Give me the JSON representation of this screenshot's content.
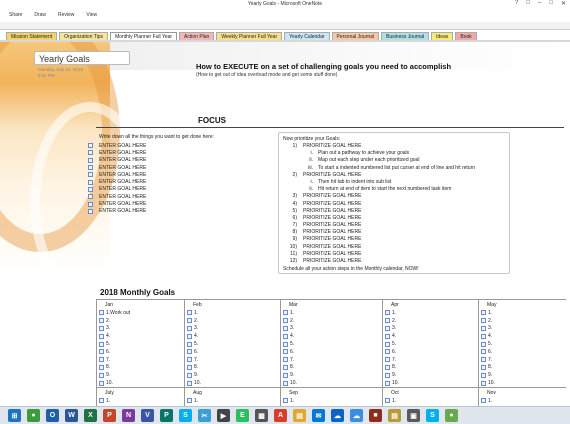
{
  "window": {
    "title": "Yearly Goals - Microsoft OneNote",
    "controls": [
      "?",
      "□",
      "–",
      "□",
      "✕"
    ]
  },
  "ribbon": {
    "tabs": [
      "Share",
      "Draw",
      "Review",
      "View"
    ]
  },
  "sections": [
    {
      "label": "Mission Statement",
      "color": "#f3d36a"
    },
    {
      "label": "Organization Tips",
      "color": "#f5e69a"
    },
    {
      "label": "Monthly Planner Full Year",
      "color": "#ffffff",
      "active": true
    },
    {
      "label": "Action Plan",
      "color": "#f5b6b6"
    },
    {
      "label": "Weekly Planner Full Year",
      "color": "#f7e08a"
    },
    {
      "label": "Yearly Calendar",
      "color": "#c9e7f6"
    },
    {
      "label": "Personal Journal",
      "color": "#f6c9a6"
    },
    {
      "label": "Business Journal",
      "color": "#aee0e8"
    },
    {
      "label": "Ideas",
      "color": "#f8ea7a"
    },
    {
      "label": "Book",
      "color": "#f0a9a9"
    }
  ],
  "page": {
    "title": "Yearly Goals",
    "date": "Monday, July 16, 2018",
    "time": "9:01 PM",
    "headline": "How to EXECUTE on a set of challenging goals you need to accomplish",
    "subheadline": "(How to get out of idea overload mode and get some stuff done)",
    "focus_label": "FOCUS",
    "write_prompt": "Write down all the things you want to get done here:",
    "goals": [
      "ENTER GOAL HERE",
      "ENTER GOAL HERE",
      "ENTER GOAL HERE",
      "ENTER GOAL HERE",
      "ENTER GOAL HERE",
      "ENTER GOAL HERE",
      "ENTER GOAL HERE",
      "ENTER GOAL HERE",
      "ENTER GOAL HERE",
      "ENTER GOAL HERE"
    ]
  },
  "prioritize": {
    "head": "Now prioritize your Goals:",
    "item1": {
      "num": "1)",
      "text": "PRIORITIZE GOAL HERE"
    },
    "sub1": [
      {
        "num": "i.",
        "text": "Plan out a pathway to achieve your goals"
      },
      {
        "num": "ii.",
        "text": "Map out each step under each prioritized goal"
      },
      {
        "num": "iii.",
        "text": "To start a indented numbered list put curser at end of line and hit return"
      }
    ],
    "item2": {
      "num": "2)",
      "text": "PRIORITIZE GOAL HERE"
    },
    "sub2": [
      {
        "num": "i.",
        "text": "Then hit tab to indent into sub list"
      },
      {
        "num": "ii.",
        "text": "Hit return at end of item to start the next numbered task item"
      }
    ],
    "rest": [
      {
        "num": "3)",
        "text": "PRIORITIZE GOAL HERE"
      },
      {
        "num": "4)",
        "text": "PRIORITIZE GOAL HERE"
      },
      {
        "num": "5)",
        "text": "PRIORITIZE GOAL HERE"
      },
      {
        "num": "6)",
        "text": "PRIORITIZE GOAL HERE"
      },
      {
        "num": "7)",
        "text": "PRIORITIZE GOAL HERE"
      },
      {
        "num": "8)",
        "text": "PRIORITIZE GOAL HERE"
      },
      {
        "num": "9)",
        "text": "PRIORITIZE GOAL HERE"
      },
      {
        "num": "10)",
        "text": "PRIORITIZE GOAL HERE"
      },
      {
        "num": "11)",
        "text": "PRIORITIZE GOAL HERE"
      },
      {
        "num": "12)",
        "text": "PRIORITIZE GOAL HERE"
      }
    ],
    "foot": "Schedule all your action steps in the Monthly calendar, NOW!"
  },
  "monthly": {
    "title": "2018 Monthly Goals",
    "row1": [
      {
        "name": "Jan",
        "entries": [
          "1.Work out",
          "2.",
          "3.",
          "4.",
          "5.",
          "6.",
          "7.",
          "8.",
          "9.",
          "10."
        ]
      },
      {
        "name": "Feb",
        "entries": [
          "1.",
          "2.",
          "3.",
          "4.",
          "5.",
          "6.",
          "7.",
          "8.",
          "9.",
          "10."
        ]
      },
      {
        "name": "Mar",
        "entries": [
          "1.",
          "2.",
          "3.",
          "4.",
          "5.",
          "6.",
          "7.",
          "8.",
          "9.",
          "10."
        ]
      },
      {
        "name": "Apr",
        "entries": [
          "1.",
          "2.",
          "3.",
          "4.",
          "5.",
          "6.",
          "7.",
          "8.",
          "9.",
          "10."
        ]
      },
      {
        "name": "May",
        "entries": [
          "1.",
          "2.",
          "3.",
          "4.",
          "5.",
          "6.",
          "7.",
          "8.",
          "9.",
          "10."
        ]
      }
    ],
    "row2": [
      {
        "name": "July",
        "entries": [
          "1."
        ]
      },
      {
        "name": "Aug",
        "entries": [
          "1."
        ]
      },
      {
        "name": "Sep",
        "entries": [
          "1."
        ]
      },
      {
        "name": "Oct",
        "entries": [
          "1."
        ]
      },
      {
        "name": "Nov",
        "entries": [
          "1."
        ]
      }
    ]
  },
  "taskbar": {
    "apps": [
      {
        "name": "start-icon",
        "color": "#1e73c6",
        "glyph": "⊞"
      },
      {
        "name": "chrome-icon",
        "color": "#3d9a3d",
        "glyph": "●"
      },
      {
        "name": "outlook-icon",
        "color": "#1f5fa8",
        "glyph": "O"
      },
      {
        "name": "word-icon",
        "color": "#2b5797",
        "glyph": "W"
      },
      {
        "name": "excel-icon",
        "color": "#1f7244",
        "glyph": "X"
      },
      {
        "name": "powerpoint-icon",
        "color": "#c5462b",
        "glyph": "P"
      },
      {
        "name": "onenote-icon",
        "color": "#7a3b9a",
        "glyph": "N"
      },
      {
        "name": "visio-icon",
        "color": "#3955a3",
        "glyph": "V"
      },
      {
        "name": "publisher-icon",
        "color": "#077568",
        "glyph": "P"
      },
      {
        "name": "skype-icon",
        "color": "#00aff0",
        "glyph": "S"
      },
      {
        "name": "snip-icon",
        "color": "#3a9fd6",
        "glyph": "✂"
      },
      {
        "name": "video-icon",
        "color": "#444444",
        "glyph": "▶"
      },
      {
        "name": "evernote-icon",
        "color": "#2dbe60",
        "glyph": "E"
      },
      {
        "name": "app-icon",
        "color": "#555555",
        "glyph": "▦"
      },
      {
        "name": "acrobat-icon",
        "color": "#d83b2b",
        "glyph": "A"
      },
      {
        "name": "folder-icon",
        "color": "#e0a82e",
        "glyph": "▤"
      },
      {
        "name": "email-icon",
        "color": "#0078d4",
        "glyph": "✉"
      },
      {
        "name": "onedrive-icon",
        "color": "#0a64c8",
        "glyph": "☁"
      },
      {
        "name": "cloud-icon",
        "color": "#3c8fe0",
        "glyph": "☁"
      },
      {
        "name": "media-icon",
        "color": "#8a2d1d",
        "glyph": "■"
      },
      {
        "name": "explorer-icon",
        "color": "#b99b3c",
        "glyph": "▤"
      },
      {
        "name": "photos-icon",
        "color": "#5a5a5a",
        "glyph": "▣"
      },
      {
        "name": "skype2-icon",
        "color": "#00aff0",
        "glyph": "S"
      },
      {
        "name": "chat-icon",
        "color": "#6aa84f",
        "glyph": "●"
      }
    ]
  }
}
